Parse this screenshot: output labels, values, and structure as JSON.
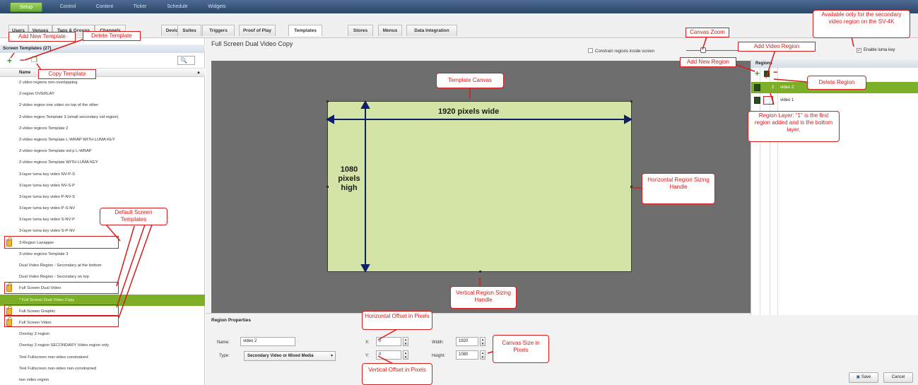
{
  "nav": {
    "items": [
      "Setup",
      "Control",
      "Content",
      "Ticker",
      "Schedule",
      "Widgets"
    ],
    "active": "Setup"
  },
  "tabs": {
    "items": [
      "Users",
      "Venues",
      "Tags & Groups",
      "Channels",
      "Devices",
      "Suites",
      "Triggers",
      "Proof of Play",
      "Templates",
      "Stores",
      "Menus",
      "Data Integration"
    ],
    "active": "Templates"
  },
  "left": {
    "title": "Screen Templates (27)",
    "search_icon": "search-icon",
    "column_header": "Name",
    "templates": [
      {
        "name": "2 video regions non-overlapping",
        "default": false,
        "selected": false
      },
      {
        "name": "2-region OVERLAY",
        "default": false,
        "selected": false
      },
      {
        "name": "2-video region one video on top of the other",
        "default": false,
        "selected": false
      },
      {
        "name": "2-video region Template 3 (small secondary vid region)",
        "default": false,
        "selected": false
      },
      {
        "name": "2-video regions Template 2",
        "default": false,
        "selected": false
      },
      {
        "name": "2-video regions Template L-WRAP WITH LUMA KEY",
        "default": false,
        "selected": false
      },
      {
        "name": "2-video regions Template vid p L-WRAP",
        "default": false,
        "selected": false
      },
      {
        "name": "2-video regions Template WITH LUMA KEY",
        "default": false,
        "selected": false
      },
      {
        "name": "3-layer luma key video NV-P-S",
        "default": false,
        "selected": false
      },
      {
        "name": "3-layer luma key video NV-S-P",
        "default": false,
        "selected": false
      },
      {
        "name": "3-layer luma key video P-NV-S",
        "default": false,
        "selected": false
      },
      {
        "name": "3-layer luma key video P-S-NV",
        "default": false,
        "selected": false
      },
      {
        "name": "3-layer luma key video S-NV-P",
        "default": false,
        "selected": false
      },
      {
        "name": "3-layer luma key video S-P-NV",
        "default": false,
        "selected": false
      },
      {
        "name": "3-Region Lwrapper",
        "default": true,
        "selected": false
      },
      {
        "name": "3-video regions Template 3",
        "default": false,
        "selected": false
      },
      {
        "name": "Dual Video Region - Secondary at the bottom",
        "default": false,
        "selected": false
      },
      {
        "name": "Dual Video Region - Secondary on top",
        "default": false,
        "selected": false
      },
      {
        "name": "Full Screen Dual Video",
        "default": true,
        "selected": false
      },
      {
        "name": "* Full Screen Dual Video Copy",
        "default": false,
        "selected": true
      },
      {
        "name": "Full Screen Graphic",
        "default": true,
        "selected": false
      },
      {
        "name": "Full Screen Video",
        "default": true,
        "selected": false
      },
      {
        "name": "Overlay 2-region",
        "default": false,
        "selected": false
      },
      {
        "name": "Overlay 2-region SECONDARY Video region only",
        "default": false,
        "selected": false
      },
      {
        "name": "Test Fullscreen non-video constrained",
        "default": false,
        "selected": false
      },
      {
        "name": "Test Fullscreen non-video non-constrained",
        "default": false,
        "selected": false
      },
      {
        "name": "two video region",
        "default": false,
        "selected": false
      }
    ]
  },
  "main": {
    "template_name": "Full Screen Dual Video Copy",
    "constrain_label": "Constrain regions inside screen",
    "luma_label": "Enable luma key",
    "canvas": {
      "width_label": "1920 pixels wide",
      "height_label": "1080\npixels\nhigh"
    }
  },
  "regions": {
    "title": "Regions",
    "rows": [
      {
        "layer": "2",
        "name": "video 2",
        "active": true
      },
      {
        "layer": "1",
        "name": "video 1",
        "active": false
      }
    ]
  },
  "properties": {
    "title": "Region Properties",
    "name_label": "Name:",
    "name_value": "video 2",
    "type_label": "Type:",
    "type_value": "Secondary Video or Mixed Media",
    "x_label": "X:",
    "x_value": "0",
    "y_label": "Y:",
    "y_value": "0",
    "width_label": "Width:",
    "width_value": "1920",
    "height_label": "Height:",
    "height_value": "1080"
  },
  "buttons": {
    "save": "Save",
    "cancel": "Cancel"
  },
  "annotations": {
    "add_new_template": "Add New Template",
    "delete_template": "Delete Template",
    "copy_template": "Copy Template",
    "default_templates": "Default Screen Templates",
    "template_canvas": "Template Canvas",
    "canvas_zoom": "Canvas Zoom",
    "luma_note": "Available only for the secondary video region on the SV-4K",
    "add_video_region": "Add Video Region",
    "add_new_region": "Add New Region",
    "delete_region": "Delete Region",
    "region_layer": "Region Layer: \"1\" is the first region added and is the bottom layer.",
    "horizontal_handle": "Horizontal Region Sizing Handle",
    "vertical_handle": "Vertical Region Sizing Handle",
    "horizontal_offset": "Horizontal Offset in Pixels",
    "vertical_offset": "Vertical Offset in Pixels",
    "canvas_size": "Canvas Size in Pixels"
  },
  "colors": {
    "accent_green": "#7cae28",
    "annotation_red": "#d81c1c",
    "canvas_gray": "#6e6e6e",
    "region_fill": "#d4e4a6"
  }
}
